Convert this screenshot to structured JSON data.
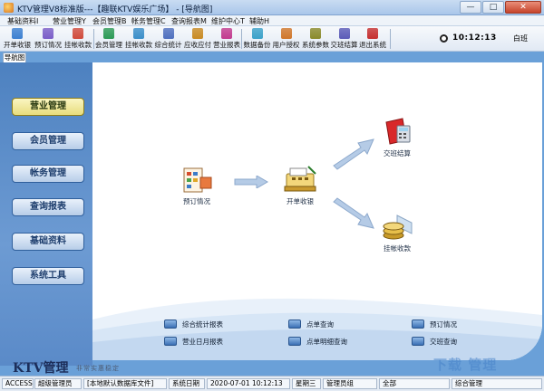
{
  "window": {
    "title": "KTV管理V8标准版---【趣联KTV娱乐广场】 - [导航图]",
    "controls": [
      "—",
      "□",
      "✕"
    ]
  },
  "menu": [
    "基础资料I",
    "营业管理Y",
    "会员管理B",
    "帐务管理C",
    "查询报表M",
    "维护中心T",
    "辅助H"
  ],
  "toolbar": {
    "buttons": [
      {
        "label": "开单收银",
        "icon": "cash-register-icon",
        "color": "#3b7fd1"
      },
      {
        "label": "预订情况",
        "icon": "booking-icon",
        "color": "#7a5dc8"
      },
      {
        "label": "挂帐收款",
        "icon": "credit-icon",
        "color": "#d14a3b"
      },
      {
        "label": "会员管理",
        "icon": "member-icon",
        "color": "#2b9a55"
      },
      {
        "label": "挂帐收款",
        "icon": "credit-card-icon",
        "color": "#3a8ec9"
      },
      {
        "label": "综合统计",
        "icon": "statistics-icon",
        "color": "#4f6fbf"
      },
      {
        "label": "应收应付",
        "icon": "receivable-icon",
        "color": "#c98a22"
      },
      {
        "label": "营业报表",
        "icon": "report-icon",
        "color": "#c23a8e"
      },
      {
        "label": "数据备份",
        "icon": "backup-icon",
        "color": "#3aa1c9"
      },
      {
        "label": "用户授权",
        "icon": "user-auth-icon",
        "color": "#d0762a"
      },
      {
        "label": "系统参数",
        "icon": "settings-icon",
        "color": "#8a8a2a"
      },
      {
        "label": "交班结算",
        "icon": "handover-icon",
        "color": "#5b5bb8"
      },
      {
        "label": "退出系统",
        "icon": "exit-icon",
        "color": "#c62f2f"
      }
    ],
    "clock": "10:12:13",
    "shift": "白班"
  },
  "nav_tab": "导航图",
  "sidebar": [
    {
      "label": "营业管理",
      "active": true
    },
    {
      "label": "会员管理",
      "active": false
    },
    {
      "label": "帐务管理",
      "active": false
    },
    {
      "label": "查询报表",
      "active": false
    },
    {
      "label": "基础资料",
      "active": false
    },
    {
      "label": "系统工具",
      "active": false
    }
  ],
  "flow": {
    "booking": {
      "label": "预订情况",
      "icon": "booking-icon"
    },
    "cashier": {
      "label": "开单收银",
      "icon": "cash-register-icon"
    },
    "handover": {
      "label": "交班结算",
      "icon": "calculator-icon"
    },
    "credit": {
      "label": "挂帐收款",
      "icon": "coins-icon"
    }
  },
  "quick_links": [
    {
      "label": "综合统计报表"
    },
    {
      "label": "点单查询"
    },
    {
      "label": "预订情况"
    },
    {
      "label": "营业日月报表"
    },
    {
      "label": "点单明细查询"
    },
    {
      "label": "交班查询"
    }
  ],
  "brand": {
    "name": "KTV管理",
    "tagline": "非常实惠稳定"
  },
  "status": [
    {
      "text": "ACCESS"
    },
    {
      "text": "超级管理员"
    },
    {
      "text": "[本地默认数据库文件]"
    },
    {
      "text": "系统日期"
    },
    {
      "text": "2020-07-01  10:12:13"
    },
    {
      "text": "星期三"
    },
    {
      "text": "管理员组"
    },
    {
      "text": "全部"
    },
    {
      "text": "综合管理"
    }
  ],
  "watermark": "下载 管理"
}
